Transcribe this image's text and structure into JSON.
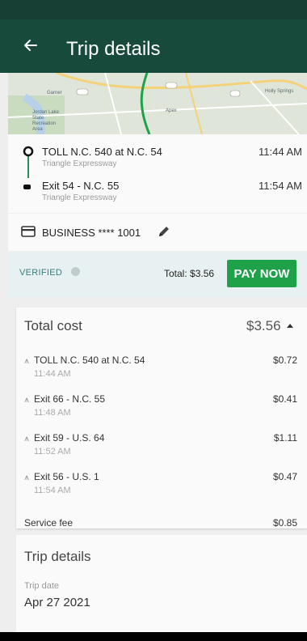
{
  "appbar": {
    "title": "Trip details",
    "back_icon": "arrow-left-icon"
  },
  "map": {
    "labels": [
      "Garner",
      "Apex",
      "Jordan Lake State Recreation Area",
      "Holly Springs"
    ]
  },
  "route": {
    "start": {
      "name": "TOLL N.C. 540 at N.C. 54",
      "road": "Triangle Expressway",
      "time": "11:44 AM"
    },
    "end": {
      "name": "Exit 54 - N.C. 55",
      "road": "Triangle Expressway",
      "time": "11:54 AM"
    }
  },
  "payment": {
    "account": "BUSINESS **** 1001",
    "card_icon": "credit-card-icon",
    "edit_icon": "pencil-icon"
  },
  "verify": {
    "status": "VERIFIED",
    "total": "Total: $3.56",
    "pay_button": "PAY NOW"
  },
  "cost": {
    "title": "Total cost",
    "amount": "$3.56",
    "items": [
      {
        "name": "TOLL N.C. 540 at N.C. 54",
        "time": "11:44 AM",
        "amount": "$0.72"
      },
      {
        "name": "Exit 66 - N.C. 55",
        "time": "11:48 AM",
        "amount": "$0.41"
      },
      {
        "name": "Exit 59 - U.S. 64",
        "time": "11:52 AM",
        "amount": "$1.11"
      },
      {
        "name": "Exit 56 - U.S. 1",
        "time": "11:54 AM",
        "amount": "$0.47"
      }
    ],
    "fee_label": "Service fee",
    "fee_amount": "$0.85"
  },
  "trip": {
    "title": "Trip details",
    "date_label": "Trip date",
    "date": "Apr 27 2021"
  },
  "colors": {
    "appbar": "#174a3b",
    "accent": "#1fa14a",
    "route_line": "#2e8b57",
    "verified": "#3b7c7a"
  }
}
